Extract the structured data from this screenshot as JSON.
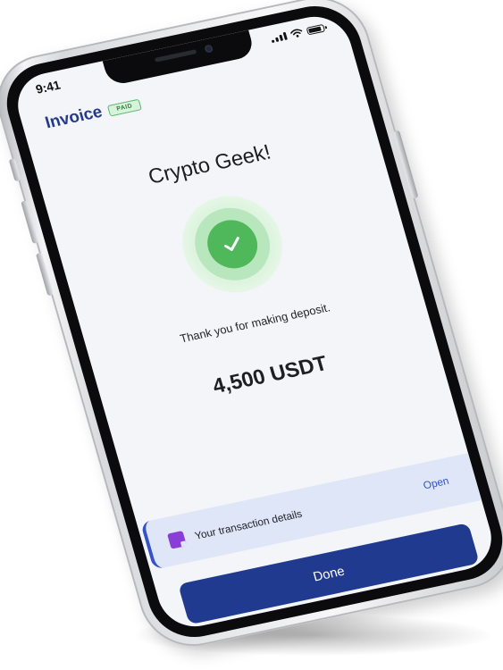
{
  "status_bar": {
    "time": "9:41"
  },
  "header": {
    "title": "Invoice",
    "badge": "PAID"
  },
  "main": {
    "headline": "Crypto Geek!",
    "status_icon": "check-icon",
    "message": "Thank you for making deposit.",
    "amount": "4,500 USDT"
  },
  "transaction_card": {
    "icon": "document-icon",
    "label": "Your transaction details",
    "action": "Open"
  },
  "footer": {
    "done_label": "Done"
  },
  "colors": {
    "brand": "#243a8c",
    "button": "#203a8f",
    "success": "#4fb85a",
    "badge_bg": "#d8f3dc",
    "card_bg": "#dfe6f7",
    "accent": "#3553c7",
    "icon_purple": "#8a3ed6"
  }
}
